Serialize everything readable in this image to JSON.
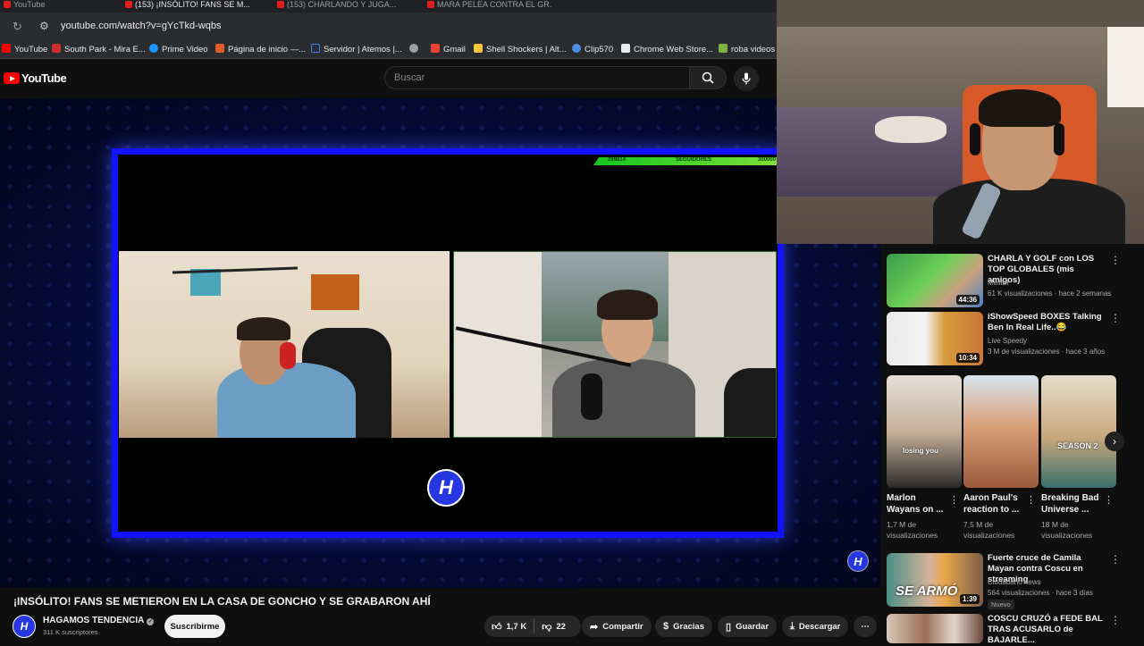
{
  "browser": {
    "tabs": [
      {
        "label": "YouTube"
      },
      {
        "label": "(153) ¡INSÓLITO! FANS SE M..."
      },
      {
        "label": "(153) CHARLANDO Y JUGA..."
      },
      {
        "label": "MARA PELEA CONTRA EL GR..."
      }
    ],
    "url": "youtube.com/watch?v=gYcTkd-wqbs",
    "bookmarks": [
      {
        "label": "YouTube",
        "color": "#ff0000"
      },
      {
        "label": "South Park - Mira E...",
        "color": "#c9302c"
      },
      {
        "label": "Prime Video",
        "color": "#1a98ff"
      },
      {
        "label": "Página de inicio —...",
        "color": "#e25c2b"
      },
      {
        "label": "Servidor | Atemos |...",
        "color": "#3b82f6"
      },
      {
        "label": "",
        "color": "#9aa0a6"
      },
      {
        "label": "Gmail",
        "color": "#ea4335"
      },
      {
        "label": "Shell Shockers | Alt...",
        "color": "#f5c542"
      },
      {
        "label": "Clip570",
        "color": "#4a90e2"
      },
      {
        "label": "Chrome Web Store...",
        "color": "#e8eaed"
      },
      {
        "label": "roba videos",
        "color": "#7cb342"
      }
    ]
  },
  "header": {
    "logo_text": "YouTube",
    "search_placeholder": "Buscar"
  },
  "player": {
    "followers_left": "299814",
    "followers_label": "SEGUIDORES",
    "followers_right": "300000",
    "logo_glyph": "H"
  },
  "video": {
    "title": "¡INSÓLITO! FANS SE METIERON EN LA CASA DE GONCHO Y SE GRABARON AHÍ",
    "channel": "HAGAMOS TENDENCIA",
    "subscribers": "311 K suscriptores",
    "subscribe_label": "Suscribirme",
    "likes": "1,7 K",
    "dislikes": "22",
    "share_label": "Compartir",
    "thanks_label": "Gracias",
    "save_label": "Guardar",
    "download_label": "Descargar"
  },
  "sidebar": {
    "videos": [
      {
        "title": "CHARLA Y GOLF con LOS TOP GLOBALES (mis amigos)",
        "channel": "Melian",
        "meta": "61 K visualizaciones · hace 2 semanas",
        "duration": "44:36"
      },
      {
        "title": "iShowSpeed BOXES Talking Ben In Real Life..😂",
        "channel": "Live Speedy",
        "meta": "3 M de visualizaciones · hace 3 años",
        "duration": "10:34"
      }
    ],
    "shorts": [
      {
        "title": "Marlon Wayans on ...",
        "views": "1,7 M de visualizaciones",
        "overlay": "losing you"
      },
      {
        "title": "Aaron Paul's reaction to ...",
        "views": "7,5 M de visualizaciones",
        "overlay": ""
      },
      {
        "title": "Breaking Bad Universe ...",
        "views": "18 M de visualizaciones",
        "overlay": "SEASON 2"
      }
    ],
    "videos2": [
      {
        "title": "Fuerte cruce de Camila Mayan contra Coscu en streaming",
        "channel": "Ciudadano news",
        "meta": "564 visualizaciones · hace 3 días",
        "duration": "1:39",
        "badge": "Nuevo",
        "overlay": "SE ARMÓ"
      },
      {
        "title": "COSCU CRUZÓ a FEDE BAL TRAS ACUSARLO de BAJARLE...",
        "channel": "",
        "meta": "",
        "duration": ""
      }
    ]
  }
}
